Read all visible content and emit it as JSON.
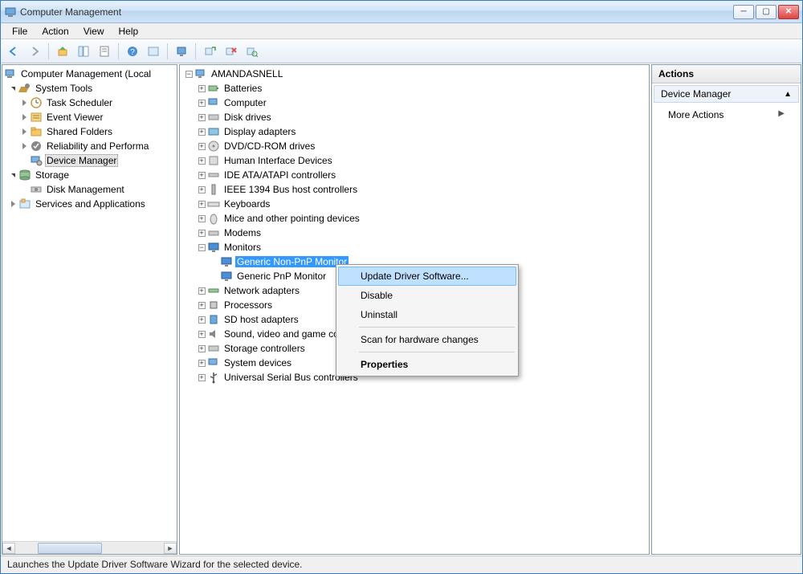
{
  "window": {
    "title": "Computer Management"
  },
  "menu": {
    "file": "File",
    "action": "Action",
    "view": "View",
    "help": "Help"
  },
  "left_tree": {
    "root": "Computer Management (Local",
    "system_tools": "System Tools",
    "task_scheduler": "Task Scheduler",
    "event_viewer": "Event Viewer",
    "shared_folders": "Shared Folders",
    "reliability": "Reliability and Performa",
    "device_manager": "Device Manager",
    "storage": "Storage",
    "disk_management": "Disk Management",
    "services_apps": "Services and Applications"
  },
  "device_tree": {
    "computer_name": "AMANDASNELL",
    "batteries": "Batteries",
    "computer": "Computer",
    "disk_drives": "Disk drives",
    "display_adapters": "Display adapters",
    "dvd": "DVD/CD-ROM drives",
    "hid": "Human Interface Devices",
    "ide": "IDE ATA/ATAPI controllers",
    "ieee1394": "IEEE 1394 Bus host controllers",
    "keyboards": "Keyboards",
    "mice": "Mice and other pointing devices",
    "modems": "Modems",
    "monitors": "Monitors",
    "generic_non_pnp": "Generic Non-PnP Monitor",
    "generic_pnp": "Generic PnP Monitor",
    "network": "Network adapters",
    "processors": "Processors",
    "sd_host": "SD host adapters",
    "sound": "Sound, video and game con",
    "storage_ctrl": "Storage controllers",
    "system_devices": "System devices",
    "usb": "Universal Serial Bus controllers"
  },
  "actions": {
    "header": "Actions",
    "section": "Device Manager",
    "more": "More Actions"
  },
  "context": {
    "update": "Update Driver Software...",
    "disable": "Disable",
    "uninstall": "Uninstall",
    "scan": "Scan for hardware changes",
    "properties": "Properties"
  },
  "status": "Launches the Update Driver Software Wizard for the selected device."
}
